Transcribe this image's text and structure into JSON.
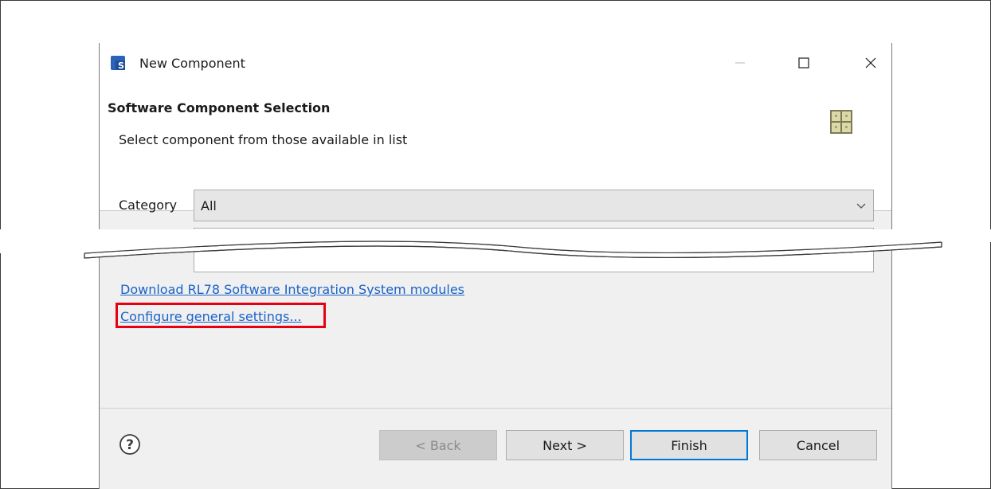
{
  "window": {
    "title": "New Component"
  },
  "header": {
    "title": "Software Component Selection",
    "subtitle": "Select component from those available in list"
  },
  "category": {
    "label": "Category",
    "value": "All"
  },
  "links": {
    "download": "Download RL78 Software Integration System modules",
    "configure": "Configure general settings..."
  },
  "buttons": {
    "back": "< Back",
    "next": "Next >",
    "finish": "Finish",
    "cancel": "Cancel"
  },
  "icons": {
    "app": "renesas-smart-configurator-icon",
    "wizard": "component-grid-icon",
    "help": "help-icon",
    "minimize": "minimize-icon",
    "maximize": "maximize-icon",
    "close": "close-icon",
    "dropdown": "chevron-down-icon"
  },
  "colors": {
    "highlight": "#e60012",
    "link": "#1a63c9",
    "default_button_border": "#0078d7",
    "dialog_background": "#f0f0f0"
  }
}
